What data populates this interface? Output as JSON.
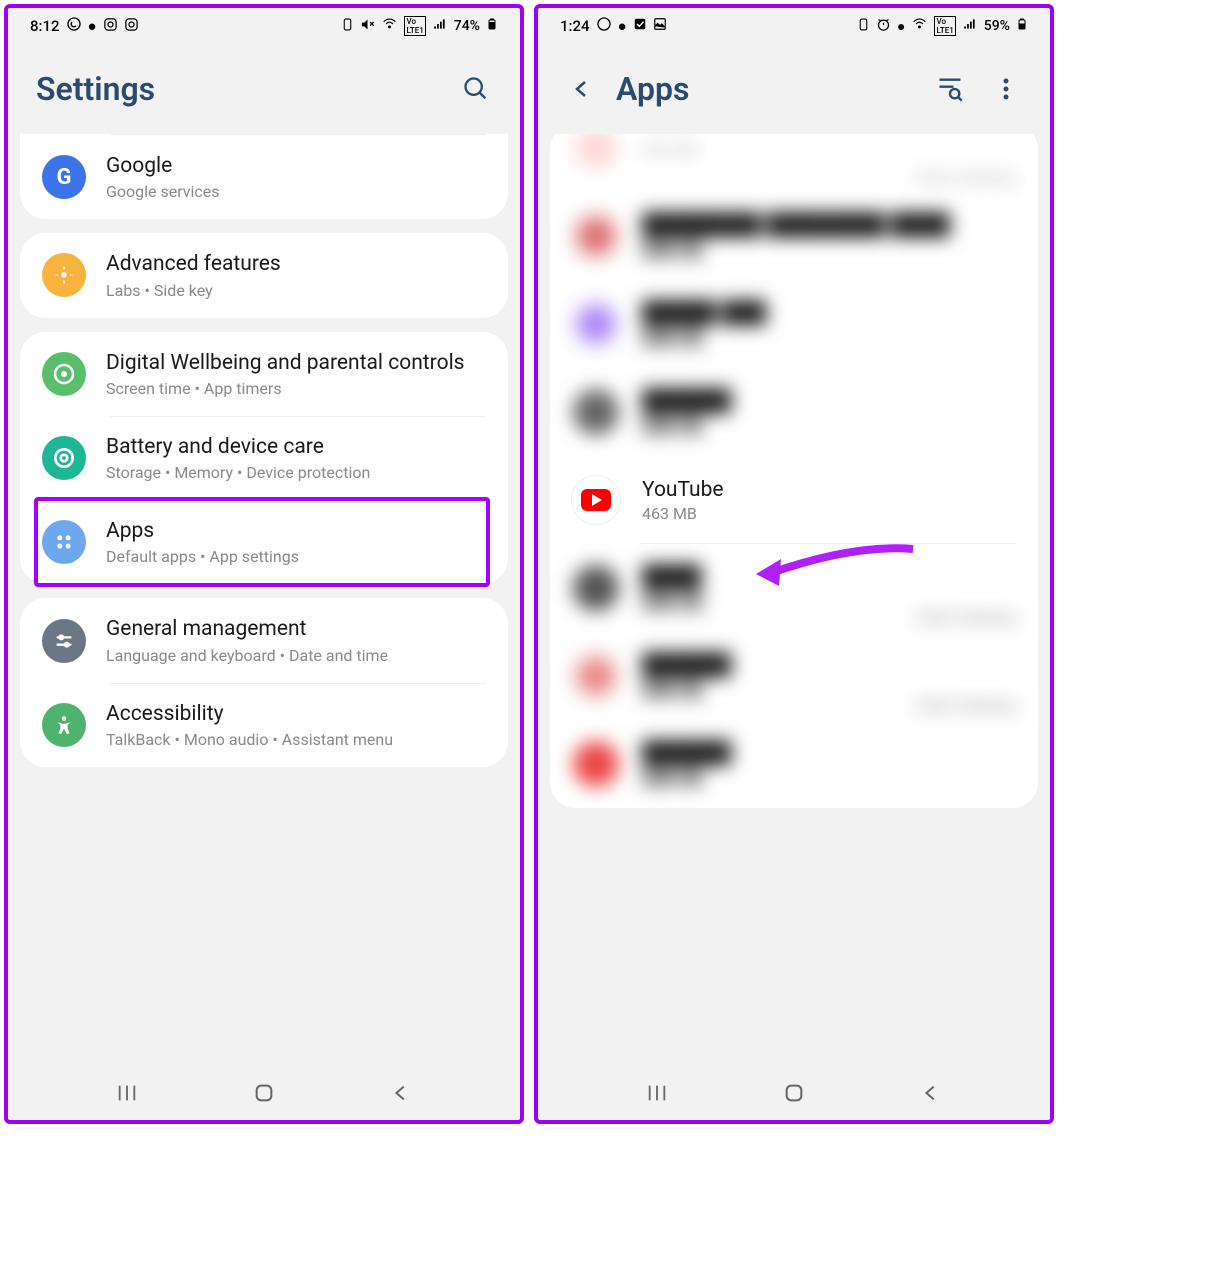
{
  "left": {
    "status": {
      "time": "8:12",
      "battery": "74%"
    },
    "header": {
      "title": "Settings"
    },
    "items": [
      {
        "title": "Google",
        "sub": "Google services",
        "icon_bg": "#3a74e8",
        "icon_label": "G",
        "icon_color": "#fff"
      },
      {
        "title": "Advanced features",
        "sub": "Labs  •  Side key",
        "icon_bg": "#f7b33d"
      },
      {
        "title": "Digital Wellbeing and parental controls",
        "sub": "Screen time  •  App timers",
        "icon_bg": "#5abf6b"
      },
      {
        "title": "Battery and device care",
        "sub": "Storage  •  Memory  •  Device protection",
        "icon_bg": "#1db796"
      },
      {
        "title": "Apps",
        "sub": "Default apps  •  App settings",
        "icon_bg": "#6da8ef"
      },
      {
        "title": "General management",
        "sub": "Language and keyboard  •  Date and time",
        "icon_bg": "#6b7784"
      },
      {
        "title": "Accessibility",
        "sub": "TalkBack  •  Mono audio  •  Assistant menu",
        "icon_bg": "#4db36e"
      }
    ]
  },
  "right": {
    "status": {
      "time": "1:24",
      "battery": "59%"
    },
    "header": {
      "title": "Apps"
    },
    "partial": {
      "size": "308 MB",
      "status": "Deep sleeping"
    },
    "youtube": {
      "name": "YouTube",
      "size": "463 MB"
    },
    "deep1": "Deep sleeping",
    "deep2": "Deep sleeping"
  }
}
